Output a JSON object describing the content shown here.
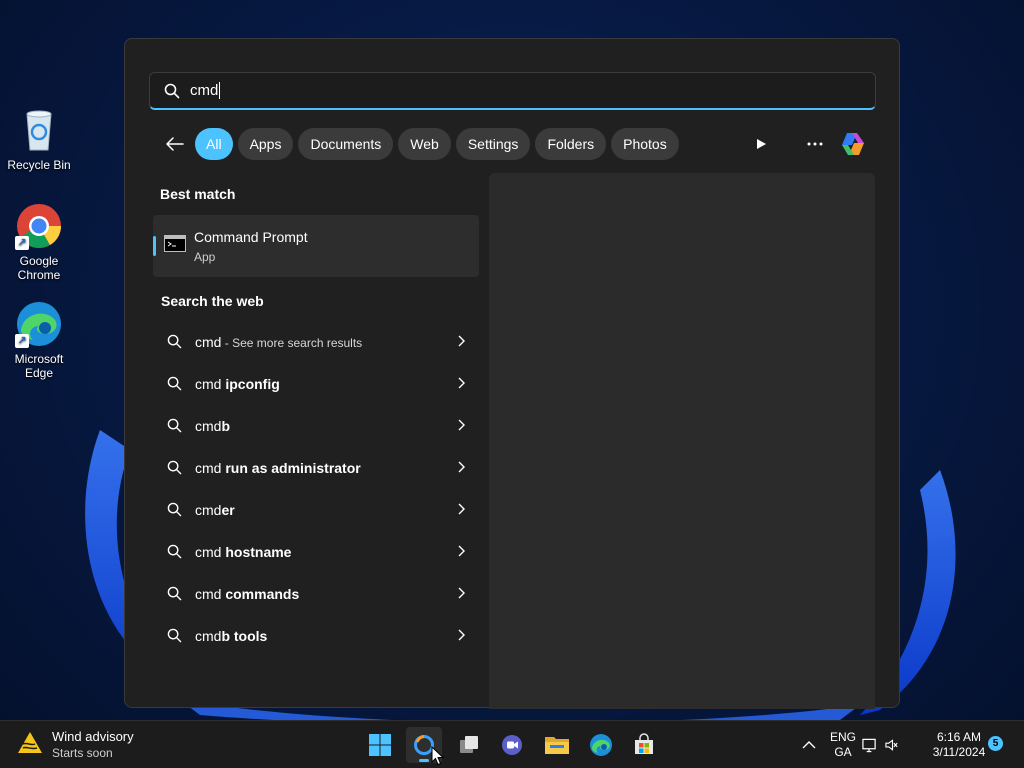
{
  "desktop": {
    "icons": [
      {
        "label": "Recycle Bin"
      },
      {
        "label": "Google\nChrome"
      },
      {
        "label": "Microsoft\nEdge"
      }
    ]
  },
  "search": {
    "query": "cmd",
    "filters": [
      "All",
      "Apps",
      "Documents",
      "Web",
      "Settings",
      "Folders",
      "Photos"
    ],
    "active_filter": "All"
  },
  "best_match": {
    "section_title": "Best match",
    "title": "Command Prompt",
    "subtitle": "App"
  },
  "web": {
    "section_title": "Search the web",
    "rows": [
      {
        "plain": "cmd",
        "bold": "",
        "more": " - See more search results"
      },
      {
        "plain": "cmd ",
        "bold": "ipconfig",
        "more": ""
      },
      {
        "plain": "cmd",
        "bold": "b",
        "more": ""
      },
      {
        "plain": "cmd ",
        "bold": "run as administrator",
        "more": ""
      },
      {
        "plain": "cmd",
        "bold": "er",
        "more": ""
      },
      {
        "plain": "cmd ",
        "bold": "hostname",
        "more": ""
      },
      {
        "plain": "cmd ",
        "bold": "commands",
        "more": ""
      },
      {
        "plain": "cmd",
        "bold": "b tools",
        "more": ""
      }
    ]
  },
  "taskbar": {
    "weather_title": "Wind advisory",
    "weather_sub": "Starts soon",
    "lang_top": "ENG",
    "lang_bottom": "GA",
    "time": "6:16 AM",
    "date": "3/11/2024",
    "notification_count": "5"
  },
  "colors": {
    "accent": "#4cc2ff",
    "panel": "#202020",
    "preview": "#2b2b2b"
  }
}
